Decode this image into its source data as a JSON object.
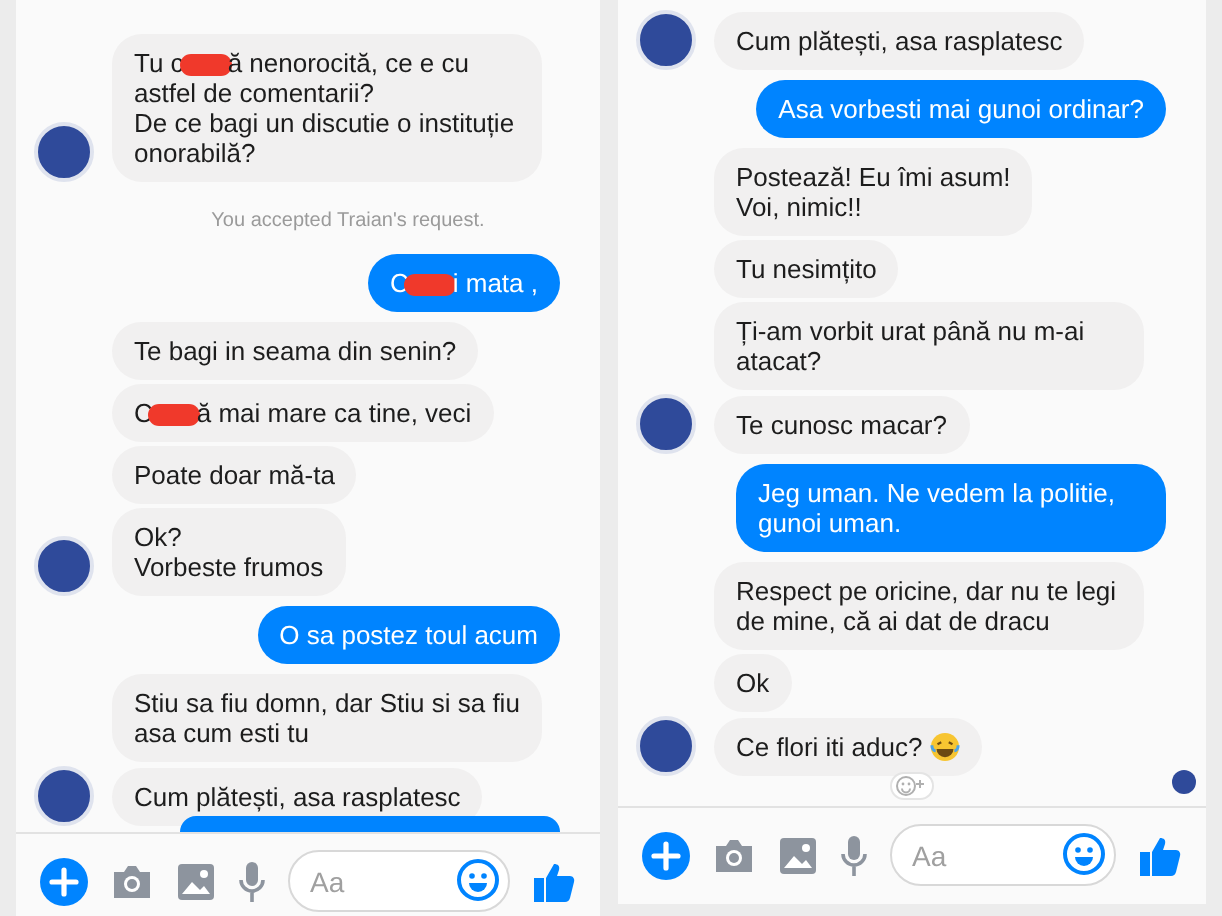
{
  "panels": [
    {
      "messages": [
        {
          "kind": "bubble",
          "outgoing": false,
          "avatar": true,
          "parts": [
            "Tu c",
            "ă nenorocită, ce e cu astfel de comentarii?\nDe ce bagi un discutie o instituție onorabilă?"
          ]
        },
        {
          "kind": "notice",
          "text": "You accepted Traian's request."
        },
        {
          "kind": "bubble",
          "outgoing": true,
          "parts": [
            "C",
            "i mata ,"
          ]
        },
        {
          "kind": "bubble",
          "outgoing": false,
          "avatar": false,
          "parts": [
            "Te bagi in seama din senin?"
          ]
        },
        {
          "kind": "bubble",
          "outgoing": false,
          "avatar": false,
          "parts": [
            "C",
            "ă mai mare ca tine, veci"
          ]
        },
        {
          "kind": "bubble",
          "outgoing": false,
          "avatar": false,
          "parts": [
            "Poate doar mă-ta"
          ]
        },
        {
          "kind": "bubble",
          "outgoing": false,
          "avatar": true,
          "parts": [
            "Ok?\nVorbeste frumos"
          ]
        },
        {
          "kind": "bubble",
          "outgoing": true,
          "parts": [
            "O sa postez toul acum"
          ]
        },
        {
          "kind": "bubble",
          "outgoing": false,
          "avatar": false,
          "parts": [
            "Stiu sa fiu domn, dar Stiu si sa fiu asa cum esti tu"
          ]
        },
        {
          "kind": "bubble",
          "outgoing": false,
          "avatar": true,
          "parts": [
            "Cum plătești, asa rasplatesc"
          ]
        },
        {
          "kind": "cut_bubble",
          "outgoing": true
        }
      ],
      "seen": false,
      "composer": {
        "placeholder": "Aa"
      }
    },
    {
      "messages": [
        {
          "kind": "bubble",
          "outgoing": false,
          "avatar": true,
          "parts": [
            "Cum plătești, asa rasplatesc"
          ]
        },
        {
          "kind": "bubble",
          "outgoing": true,
          "parts": [
            "Asa vorbesti mai gunoi ordinar?"
          ]
        },
        {
          "kind": "bubble",
          "outgoing": false,
          "avatar": false,
          "parts": [
            "Postează! Eu îmi asum!\nVoi, nimic!!"
          ]
        },
        {
          "kind": "bubble",
          "outgoing": false,
          "avatar": false,
          "parts": [
            "Tu nesimțito"
          ]
        },
        {
          "kind": "bubble",
          "outgoing": false,
          "avatar": false,
          "parts": [
            "Ți-am vorbit urat până nu m-ai atacat?"
          ]
        },
        {
          "kind": "bubble",
          "outgoing": false,
          "avatar": true,
          "parts": [
            "Te cunosc macar?"
          ]
        },
        {
          "kind": "bubble",
          "outgoing": true,
          "parts": [
            "Jeg uman. Ne vedem la politie, gunoi uman."
          ]
        },
        {
          "kind": "bubble",
          "outgoing": false,
          "avatar": false,
          "parts": [
            "Respect pe oricine, dar nu te legi de mine, că ai dat de dracu"
          ]
        },
        {
          "kind": "bubble",
          "outgoing": false,
          "avatar": false,
          "parts": [
            "Ok"
          ]
        },
        {
          "kind": "bubble",
          "outgoing": false,
          "avatar": true,
          "emoji": true,
          "reaction_button": true,
          "parts": [
            "Ce flori iti aduc?"
          ]
        }
      ],
      "seen": true,
      "composer": {
        "placeholder": "Aa"
      }
    }
  ]
}
